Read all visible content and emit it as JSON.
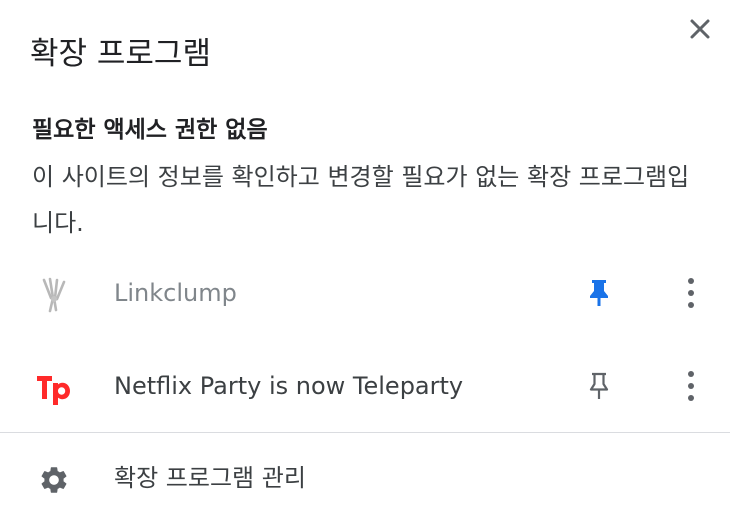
{
  "header": {
    "title": "확장 프로그램",
    "close_icon": "close-icon"
  },
  "section": {
    "heading": "필요한 액세스 권한 없음",
    "description": "이 사이트의 정보를 확인하고 변경할 필요가 없는 확장 프로그램입니다."
  },
  "extensions": [
    {
      "name": "Linkclump",
      "icon": "linkclump-icon",
      "pinned": true,
      "enabled": false
    },
    {
      "name": "Netflix Party is now Teleparty",
      "icon": "teleparty-logo-icon",
      "pinned": false,
      "enabled": true
    }
  ],
  "footer": {
    "manage_label": "확장 프로그램 관리",
    "manage_icon": "gear-icon"
  },
  "colors": {
    "pinned_accent": "#1a73e8",
    "teleparty_brand": "#ff2a2a",
    "icon_gray": "#5f6368",
    "muted_text": "#80868b"
  }
}
